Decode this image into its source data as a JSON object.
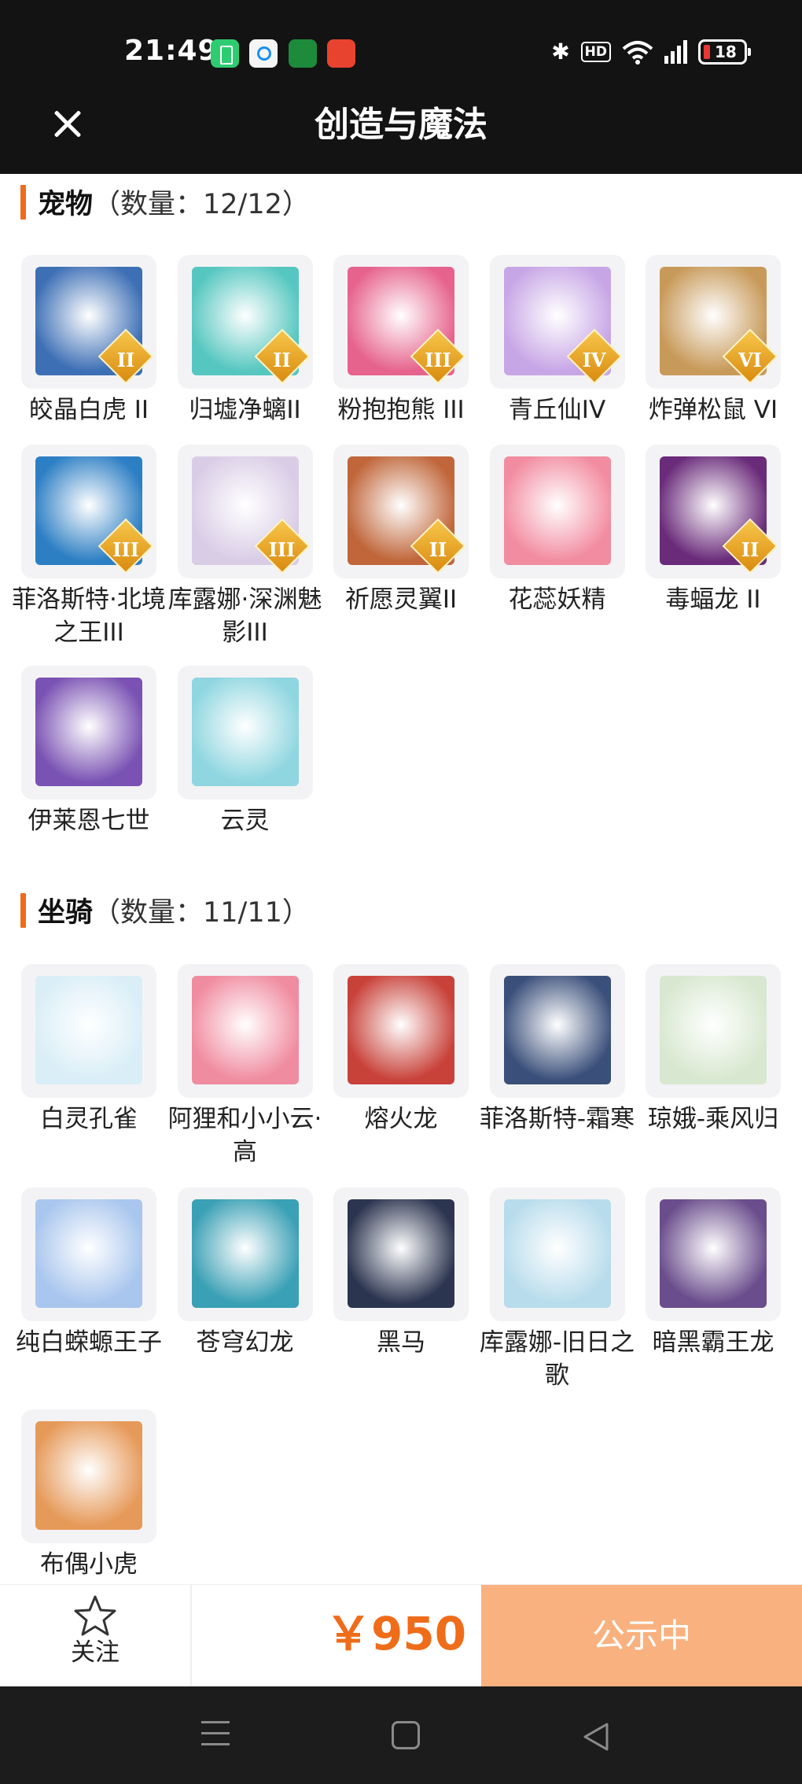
{
  "status_bar": {
    "time": "21:49",
    "battery": "18"
  },
  "header": {
    "title": "创造与魔法"
  },
  "pets": {
    "title": "宠物",
    "count": "（数量：12/12）",
    "items": [
      {
        "name": "皎晶白虎 II",
        "badge": "II",
        "art": "#3d6fb5"
      },
      {
        "name": "归墟净螭II",
        "badge": "II",
        "art": "#56c7c0"
      },
      {
        "name": "粉抱抱熊 III",
        "badge": "III",
        "art": "#e6638d"
      },
      {
        "name": "青丘仙IV",
        "badge": "IV",
        "art": "#c7a6e6"
      },
      {
        "name": "炸弹松鼠 VI",
        "badge": "VI",
        "art": "#c89a5a"
      },
      {
        "name": "菲洛斯特·北境之王III",
        "badge": "III",
        "art": "#2d7fc4"
      },
      {
        "name": "库露娜·深渊魅影III",
        "badge": "III",
        "art": "#d9cde6"
      },
      {
        "name": "祈愿灵翼II",
        "badge": "II",
        "art": "#c0663a"
      },
      {
        "name": "花蕊妖精",
        "badge": "",
        "art": "#f28ca0"
      },
      {
        "name": "毒蝠龙 II",
        "badge": "II",
        "art": "#6a2b7a"
      },
      {
        "name": "伊莱恩七世",
        "badge": "",
        "art": "#7a52b3"
      },
      {
        "name": "云灵",
        "badge": "",
        "art": "#8fd6e0"
      }
    ]
  },
  "mounts": {
    "title": "坐骑",
    "count": "（数量：11/11）",
    "items": [
      {
        "name": "白灵孔雀",
        "art": "#d9eef7"
      },
      {
        "name": "阿狸和小小云·高",
        "art": "#f08ca0"
      },
      {
        "name": "熔火龙",
        "art": "#c8423a"
      },
      {
        "name": "菲洛斯特-霜寒",
        "art": "#3a4f7a"
      },
      {
        "name": "琼娥-乘风归",
        "art": "#d8e8d0"
      },
      {
        "name": "纯白蝾螈王子",
        "art": "#a9c6ee"
      },
      {
        "name": "苍穹幻龙",
        "art": "#3aa0b5"
      },
      {
        "name": "黑马",
        "art": "#2c3550"
      },
      {
        "name": "库露娜-旧日之歌",
        "art": "#b8dcec"
      },
      {
        "name": "暗黑霸王龙",
        "art": "#6a4d8c"
      },
      {
        "name": "布偶小虎",
        "art": "#e69a5a"
      }
    ]
  },
  "bottom": {
    "follow_label": "关注",
    "price": "￥950",
    "status_label": "公示中"
  },
  "colors": {
    "accent": "#ef6c1a",
    "status_button": "#f9b17f",
    "header_bg": "#131313"
  }
}
